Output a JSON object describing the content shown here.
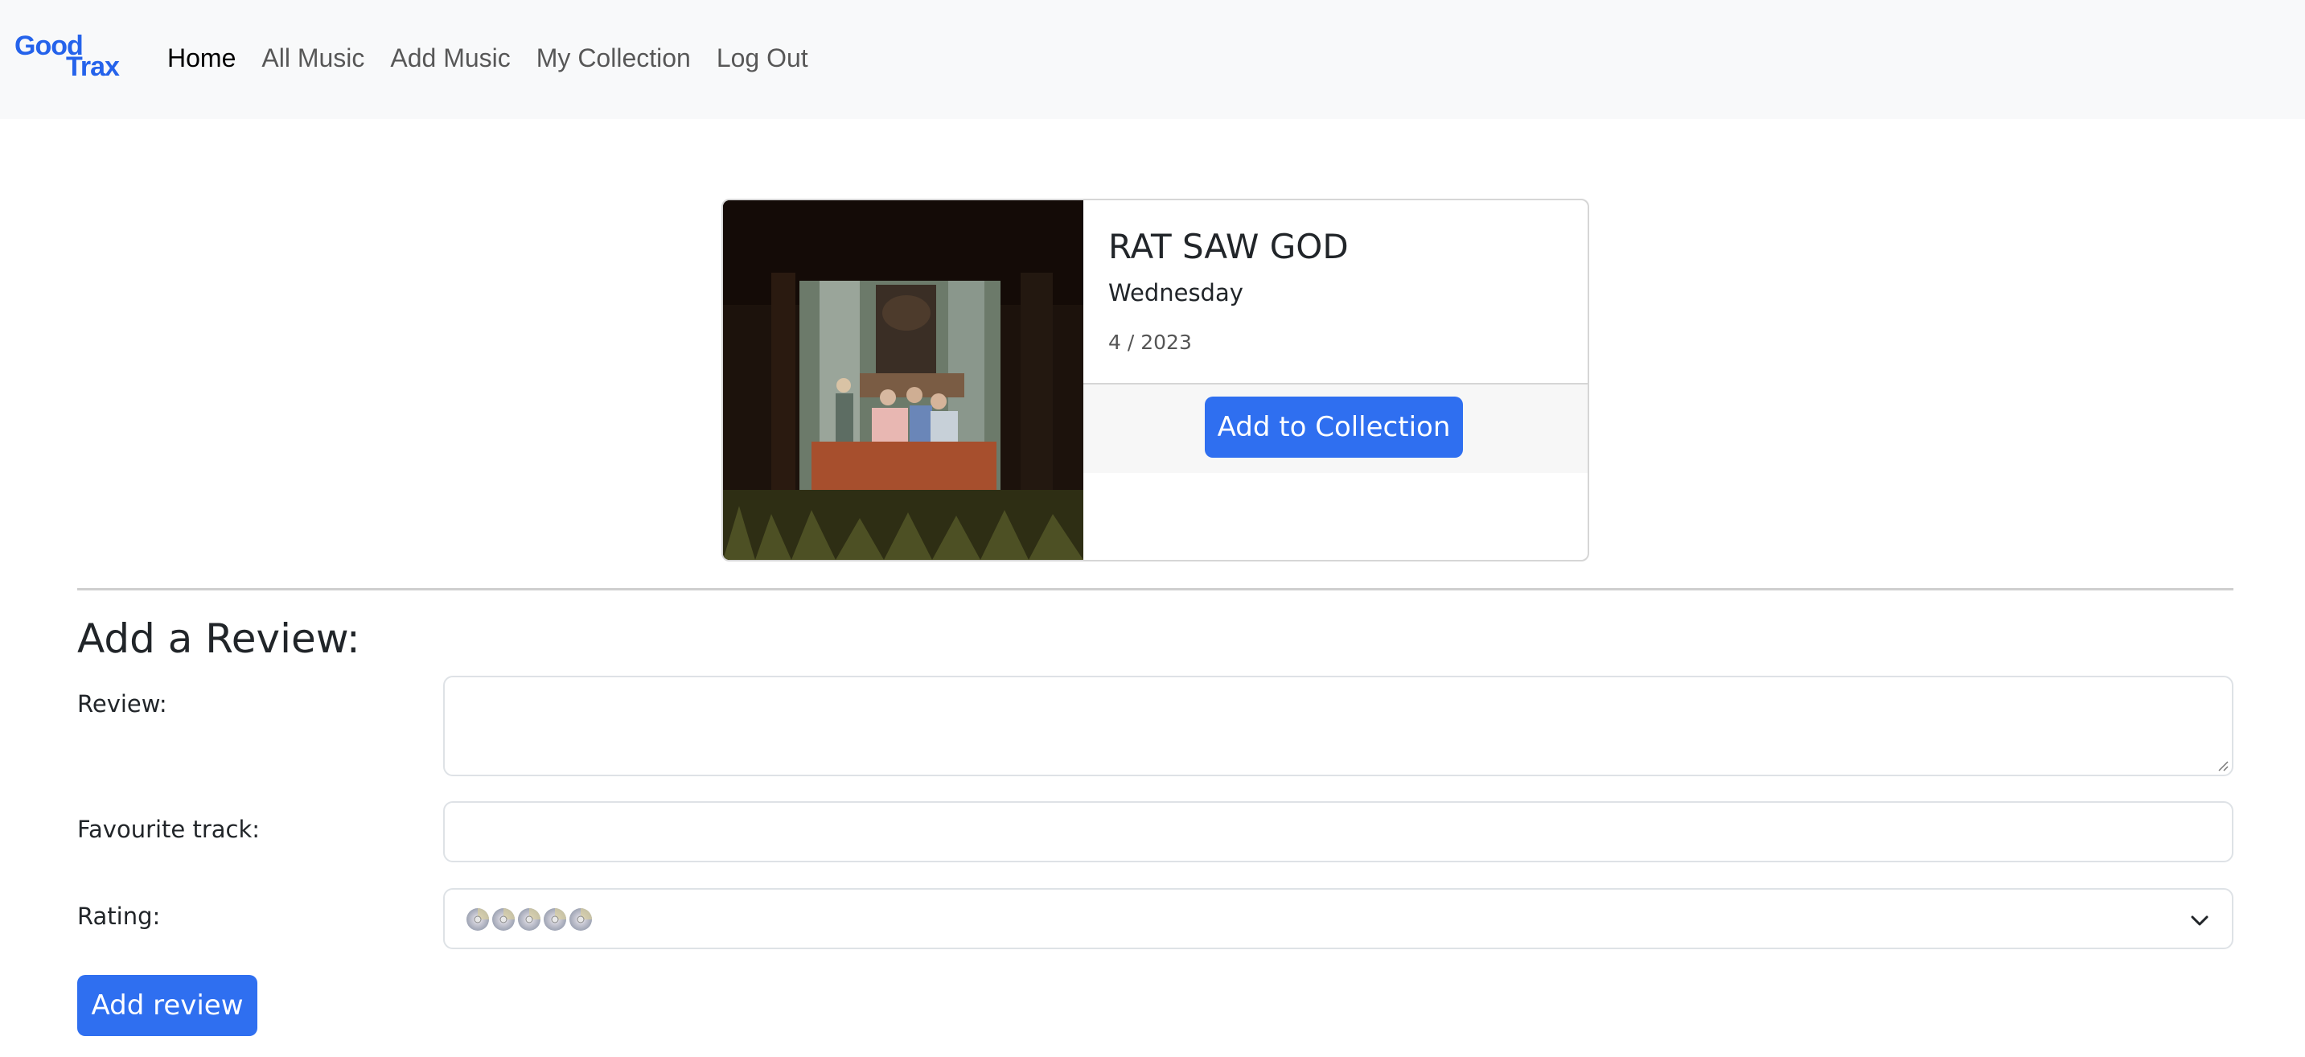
{
  "brand": {
    "line1": "Good",
    "line2": "Trax",
    "color": "#2563eb"
  },
  "nav": {
    "items": [
      {
        "label": "Home",
        "active": true
      },
      {
        "label": "All Music",
        "active": false
      },
      {
        "label": "Add Music",
        "active": false
      },
      {
        "label": "My Collection",
        "active": false
      },
      {
        "label": "Log Out",
        "active": false
      }
    ]
  },
  "album": {
    "title": "RAT SAW GOD",
    "artist": "Wednesday",
    "date": "4 / 2023",
    "add_button": "Add to Collection"
  },
  "review_form": {
    "heading": "Add a Review:",
    "review_label": "Review:",
    "review_value": "",
    "track_label": "Favourite track:",
    "track_value": "",
    "rating_label": "Rating:",
    "rating_selected": "5 discs",
    "rating_icon": "cd-disc-icon",
    "submit_label": "Add review"
  },
  "colors": {
    "primary": "#2f6ff0",
    "navbar_bg": "#f8f9fa"
  }
}
